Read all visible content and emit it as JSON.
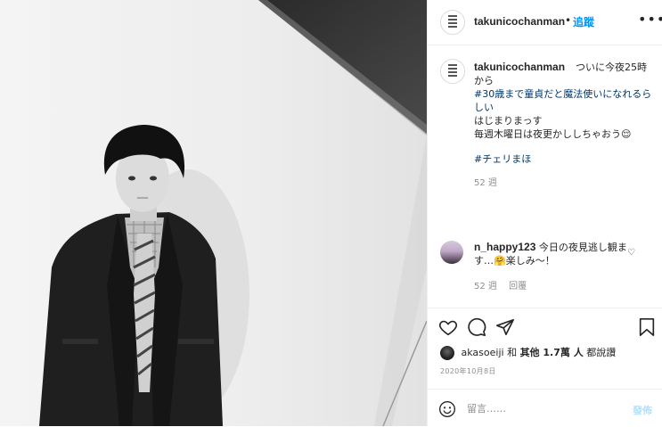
{
  "post": {
    "account": {
      "username": "takunicochanman",
      "avatar_icon": "profile-avatar-icon"
    },
    "header": {
      "separator": "•",
      "follow_label": "追蹤",
      "more_label": "•••"
    },
    "caption": {
      "text_line1": "ついに今夜25時から",
      "hashtag1": "#30歳まで童貞だと魔法使いになれるらしい",
      "line2": "はじまりまっす",
      "line3": "毎週木曜日は夜更かししちゃおう😌",
      "hashtag2": "#チェリまほ",
      "age": "52 週"
    },
    "comment": {
      "username": "n_happy123",
      "text": "今日の夜見逃し観ます…🤗楽しみ〜！",
      "age": "52 週",
      "reply_label": "回覆"
    },
    "actions": {
      "like_icon": "heart-icon",
      "comment_icon": "comment-bubble-icon",
      "share_icon": "paper-plane-icon",
      "save_icon": "bookmark-icon"
    },
    "likes": {
      "liker_username": "akasoeiji",
      "connector": "和",
      "others_count": "其他 1.7萬 人",
      "suffix": "都說讚"
    },
    "date": "2020年10月8日",
    "add_comment": {
      "placeholder": "留言……",
      "post_label": "發佈",
      "emoji_icon": "smiley-icon"
    }
  },
  "colors": {
    "accent": "#0095f6",
    "post_disabled": "#b2dffc",
    "hashtag": "#00376b",
    "meta_text": "#8e8e8e",
    "border": "#efefef"
  }
}
